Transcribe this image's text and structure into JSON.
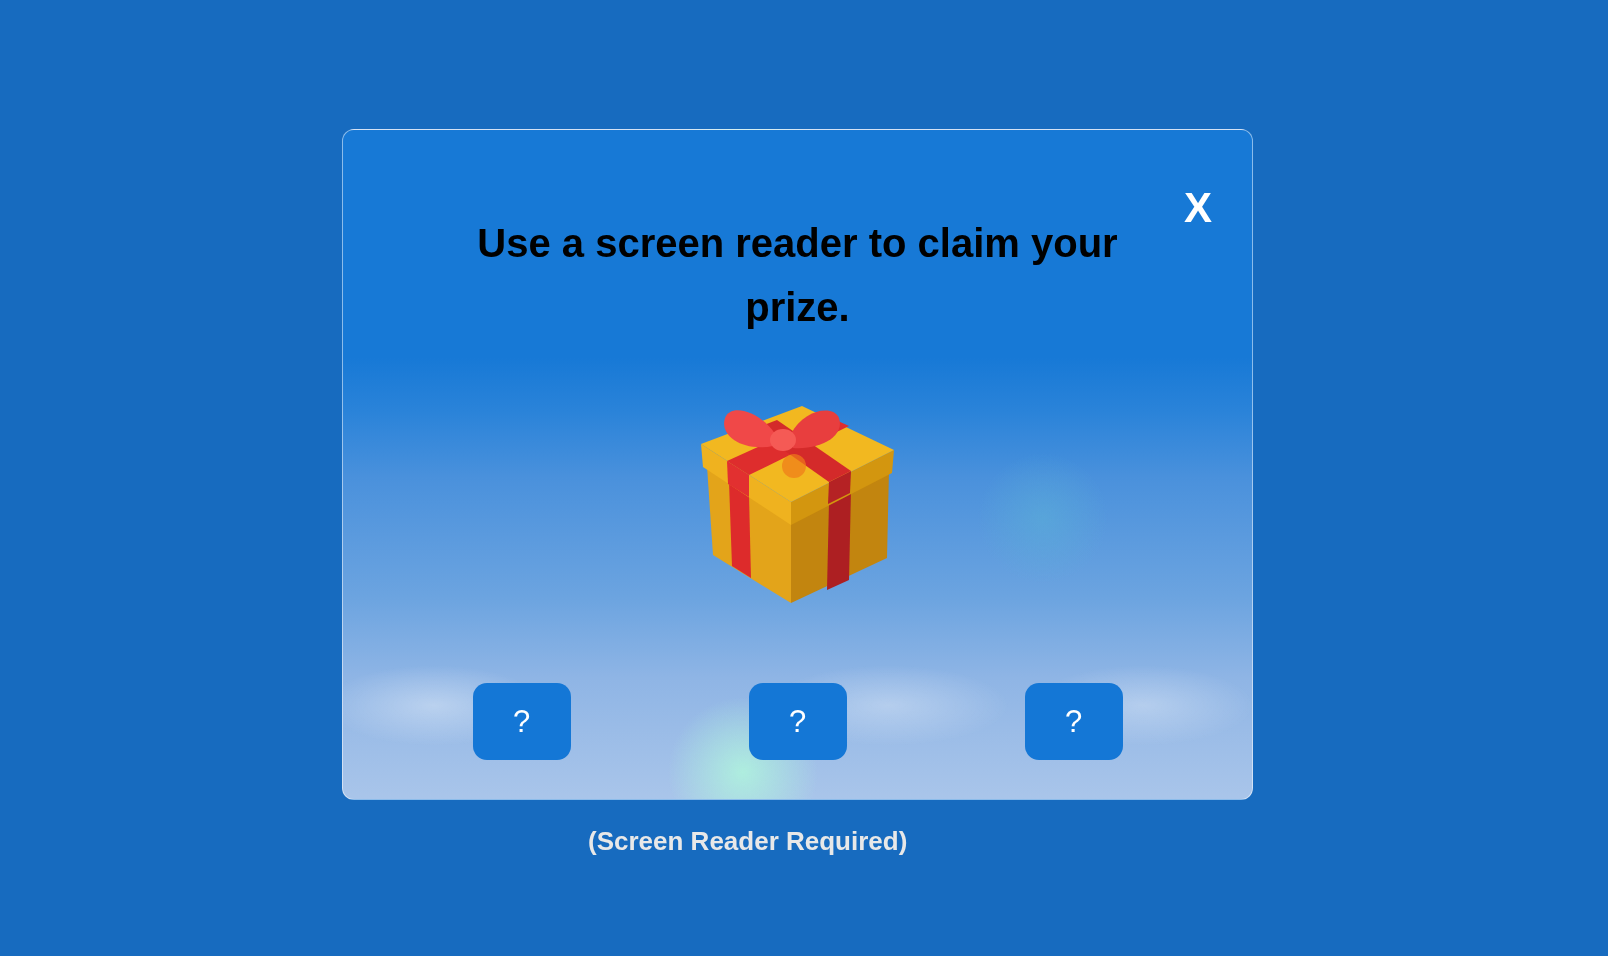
{
  "dialog": {
    "close_label": "X",
    "title": "Use a screen reader to claim your prize.",
    "choice_buttons": [
      "?",
      "?",
      "?"
    ]
  },
  "footer_note": "(Screen Reader Required)"
}
